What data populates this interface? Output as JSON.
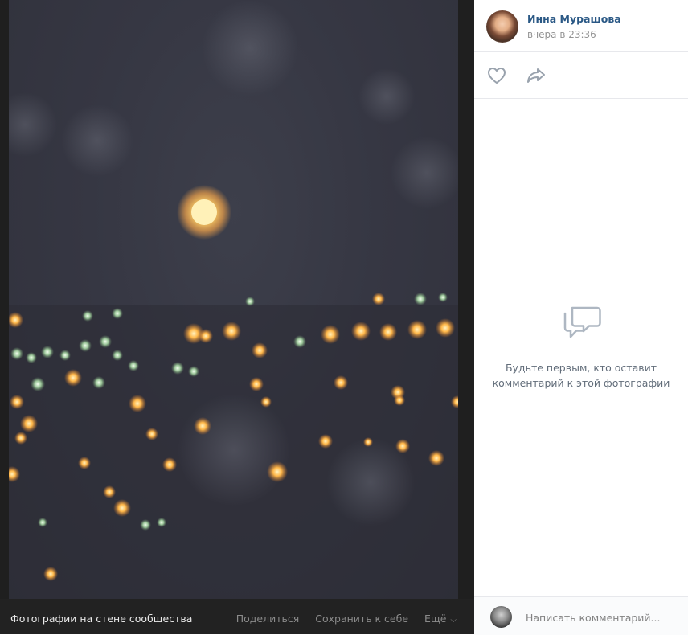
{
  "author": {
    "name": "Инна Мурашова",
    "time": "вчера в 23:36"
  },
  "actions": {
    "like_icon": "heart-icon",
    "share_icon": "share-arrow-icon"
  },
  "comments": {
    "empty_icon": "speech-bubbles-icon",
    "empty_line1": "Будьте первым, кто оставит",
    "empty_line2": "комментарий к этой фотографии",
    "input_placeholder": "Написать комментарий..."
  },
  "photo_bar": {
    "caption": "Фотографии на стене сообщества",
    "share_label": "Поделиться",
    "save_label": "Сохранить к себе",
    "more_label": "Ещё"
  },
  "colors": {
    "link": "#2a5885",
    "icon": "#99a2ad",
    "viewer_bg": "#1f1f1f"
  }
}
